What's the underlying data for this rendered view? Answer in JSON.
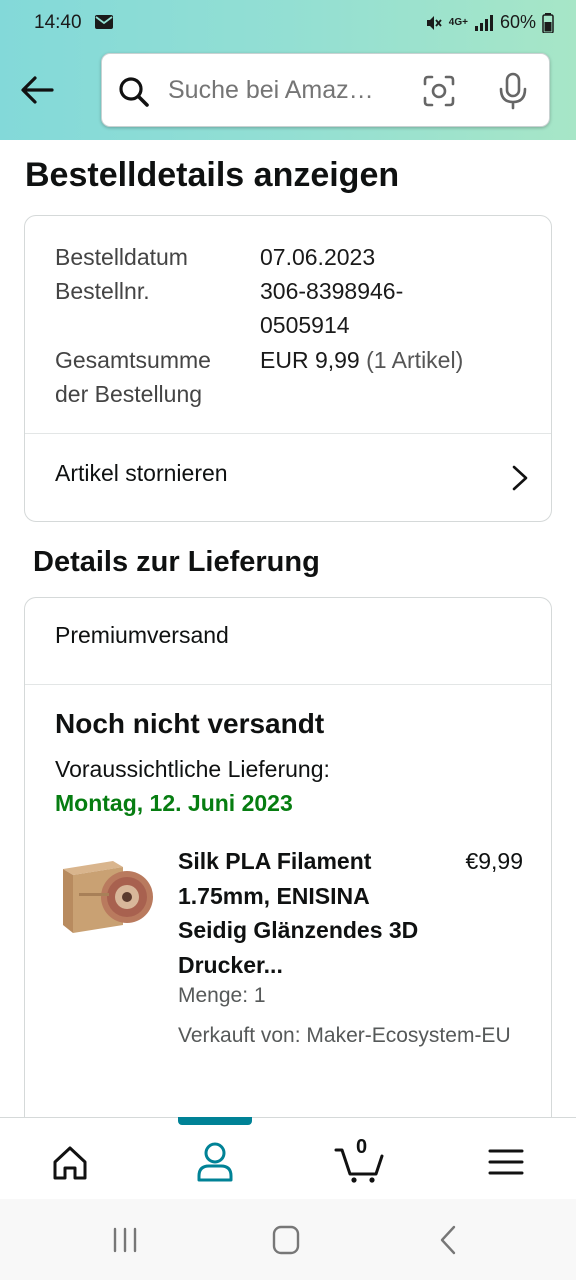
{
  "status_bar": {
    "time": "14:40",
    "network": "4G+",
    "battery": "60%"
  },
  "header": {
    "search_placeholder": "Suche bei Amaz…"
  },
  "page": {
    "title": "Bestelldetails anzeigen"
  },
  "order_summary": {
    "date_label": "Bestelldatum",
    "date_value": "07.06.2023",
    "number_label": "Bestellnr.",
    "number_value_line1": "306-8398946-",
    "number_value_line2": "0505914",
    "total_label_line1": "Gesamtsumme",
    "total_label_line2": "der Bestellung",
    "total_value": "EUR 9,99",
    "total_items": "(1 Artikel)",
    "cancel_label": "Artikel stornieren"
  },
  "delivery": {
    "section_title": "Details zur Lieferung",
    "shipping_method": "Premiumversand",
    "status": "Noch nicht versandt",
    "expected_label": "Voraussichtliche Lieferung:",
    "expected_date": "Montag, 12. Juni 2023",
    "product": {
      "title": "Silk PLA Filament 1.75mm, ENISINA Seidig Glänzendes 3D Drucker...",
      "price": "€9,99",
      "quantity": "Menge: 1",
      "seller": "Verkauft von: Maker-Ecosystem-EU"
    }
  },
  "bottom_nav": {
    "cart_count": "0",
    "active": "account",
    "accent_color": "#008296"
  },
  "colors": {
    "header_gradient_start": "#83d9d9",
    "header_gradient_end": "#a7e6c7",
    "delivery_date_green": "#067d11"
  }
}
